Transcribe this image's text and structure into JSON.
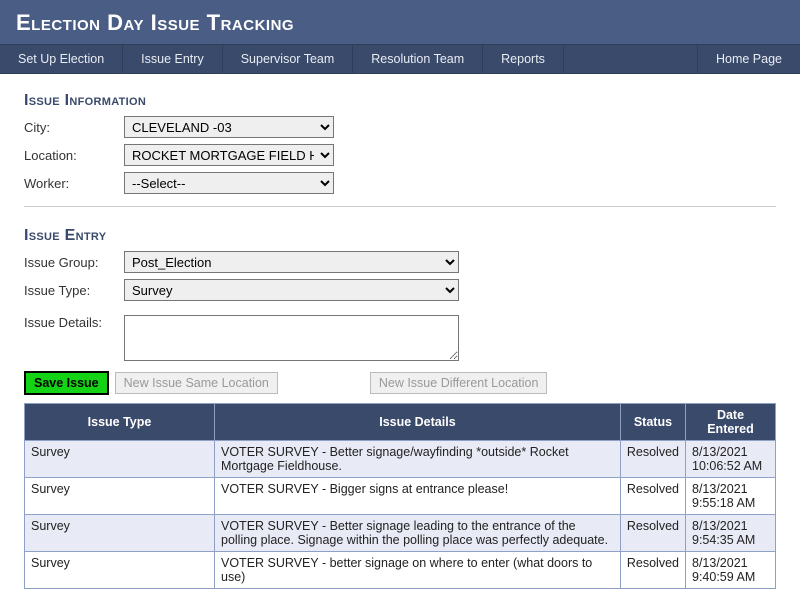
{
  "banner": {
    "title": "Election Day Issue Tracking"
  },
  "nav": {
    "items": [
      "Set Up Election",
      "Issue Entry",
      "Supervisor Team",
      "Resolution Team",
      "Reports"
    ],
    "home": "Home Page"
  },
  "issue_info": {
    "title": "Issue Information",
    "city_label": "City:",
    "city_value": "CLEVELAND -03",
    "location_label": "Location:",
    "location_value": "ROCKET MORTGAGE FIELD HOUSE",
    "worker_label": "Worker:",
    "worker_value": "--Select--"
  },
  "issue_entry": {
    "title": "Issue Entry",
    "group_label": "Issue Group:",
    "group_value": "Post_Election",
    "type_label": "Issue Type:",
    "type_value": "Survey",
    "details_label": "Issue Details:"
  },
  "buttons": {
    "save": "Save Issue",
    "new_same": "New Issue Same Location",
    "new_diff": "New Issue Different Location"
  },
  "grid": {
    "headers": {
      "type": "Issue Type",
      "details": "Issue Details",
      "status": "Status",
      "date": "Date Entered"
    },
    "rows": [
      {
        "type": "Survey",
        "details": "VOTER SURVEY - Better signage/wayfinding *outside* Rocket Mortgage Fieldhouse.",
        "status": "Resolved",
        "date": "8/13/2021 10:06:52 AM"
      },
      {
        "type": "Survey",
        "details": "VOTER SURVEY - Bigger signs at entrance please!",
        "status": "Resolved",
        "date": "8/13/2021 9:55:18 AM"
      },
      {
        "type": "Survey",
        "details": "VOTER SURVEY - Better signage leading to the entrance of the polling place. Signage within the polling place was perfectly adequate.",
        "status": "Resolved",
        "date": "8/13/2021 9:54:35 AM"
      },
      {
        "type": "Survey",
        "details": "VOTER SURVEY - better signage on where to enter (what doors to use)",
        "status": "Resolved",
        "date": "8/13/2021 9:40:59 AM"
      }
    ]
  }
}
